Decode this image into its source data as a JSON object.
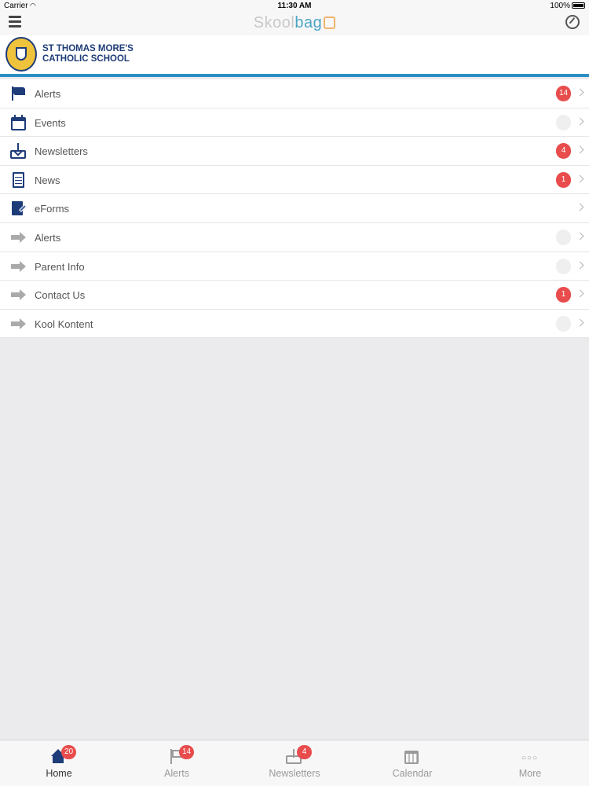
{
  "status_bar": {
    "carrier": "Carrier",
    "time": "11:30 AM",
    "battery": "100%"
  },
  "nav": {
    "brand_left": "Skool",
    "brand_right": "bag"
  },
  "school": {
    "name_line1": "ST THOMAS MORE'S",
    "name_line2": "CATHOLIC SCHOOL"
  },
  "menu": [
    {
      "label": "Alerts",
      "badge": "14",
      "icon": "flag-icon"
    },
    {
      "label": "Events",
      "badge": "",
      "icon": "calendar-icon"
    },
    {
      "label": "Newsletters",
      "badge": "4",
      "icon": "inbox-download-icon"
    },
    {
      "label": "News",
      "badge": "1",
      "icon": "document-icon"
    },
    {
      "label": "eForms",
      "badge": null,
      "icon": "form-pen-icon"
    },
    {
      "label": "Alerts",
      "badge": "",
      "icon": "arrow-right-icon"
    },
    {
      "label": "Parent Info",
      "badge": "",
      "icon": "arrow-right-icon"
    },
    {
      "label": "Contact Us",
      "badge": "1",
      "icon": "arrow-right-icon"
    },
    {
      "label": "Kool Kontent",
      "badge": "",
      "icon": "arrow-right-icon"
    }
  ],
  "tabs": [
    {
      "label": "Home",
      "badge": "20",
      "icon": "home-icon"
    },
    {
      "label": "Alerts",
      "badge": "14",
      "icon": "flag-icon"
    },
    {
      "label": "Newsletters",
      "badge": "4",
      "icon": "inbox-download-icon"
    },
    {
      "label": "Calendar",
      "badge": null,
      "icon": "calendar-icon"
    },
    {
      "label": "More",
      "badge": null,
      "icon": "more-dots-icon"
    }
  ],
  "colors": {
    "accent": "#2b8ec2",
    "brand_navy": "#1e3c78",
    "badge_red": "#e84c4c"
  }
}
